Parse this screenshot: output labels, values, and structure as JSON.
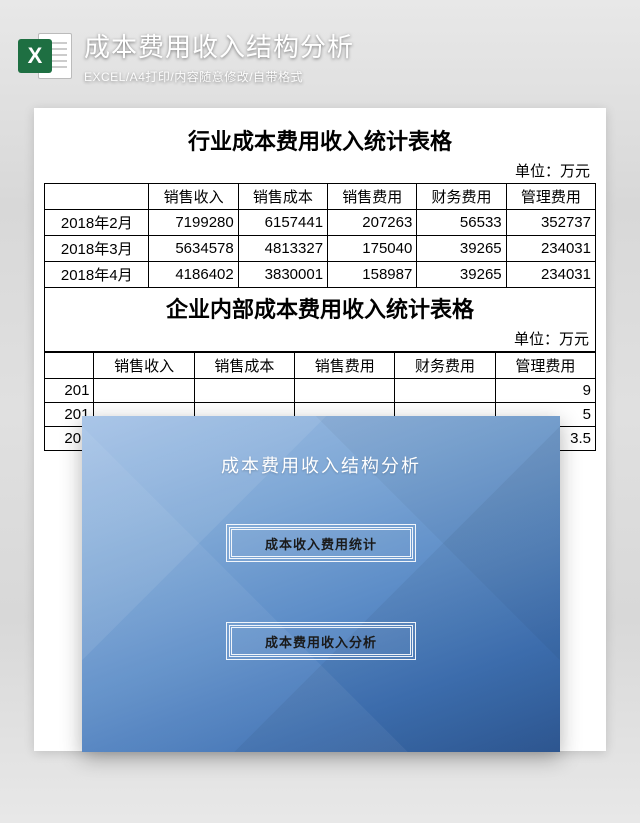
{
  "header": {
    "icon_letter": "X",
    "title": "成本费用收入结构分析",
    "subtitle": "EXCEL/A4打印/内容随意修改/自带格式"
  },
  "table1": {
    "title": "行业成本费用收入统计表格",
    "unit": "单位：万元",
    "columns": [
      "",
      "销售收入",
      "销售成本",
      "销售费用",
      "财务费用",
      "管理费用"
    ],
    "rows": [
      {
        "label": "2018年2月",
        "cells": [
          "7199280",
          "6157441",
          "207263",
          "56533",
          "352737"
        ]
      },
      {
        "label": "2018年3月",
        "cells": [
          "5634578",
          "4813327",
          "175040",
          "39265",
          "234031"
        ]
      },
      {
        "label": "2018年4月",
        "cells": [
          "4186402",
          "3830001",
          "158987",
          "39265",
          "234031"
        ]
      }
    ]
  },
  "table2": {
    "title": "企业内部成本费用收入统计表格",
    "unit": "单位：万元",
    "columns": [
      "",
      "销售收入",
      "销售成本",
      "销售费用",
      "财务费用",
      "管理费用"
    ],
    "rows": [
      {
        "label": "201",
        "tail": "9"
      },
      {
        "label": "201",
        "tail": "5"
      },
      {
        "label": "201",
        "tail": "3.5"
      }
    ]
  },
  "overlay": {
    "title": "成本费用收入结构分析",
    "button1": "成本收入费用统计",
    "button2": "成本费用收入分析"
  }
}
